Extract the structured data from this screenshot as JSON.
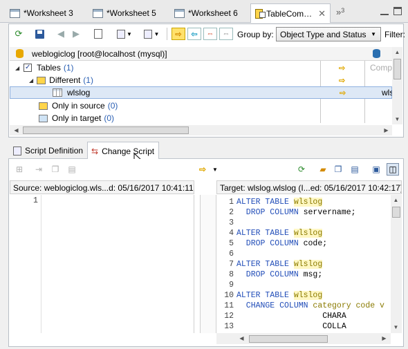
{
  "editor_tabs": [
    {
      "label": "*Worksheet 3",
      "icon": "sql-worksheet-icon"
    },
    {
      "label": "*Worksheet 5",
      "icon": "sql-worksheet-icon"
    },
    {
      "label": "*Worksheet 6",
      "icon": "sql-worksheet-icon"
    },
    {
      "label": "TableCom…",
      "icon": "table-compare-icon",
      "active": true
    }
  ],
  "overflow_tabs_count": "3",
  "toolbar": {
    "group_by_label": "Group by:",
    "group_by_value": "Object Type and Status",
    "filter_label": "Filter:"
  },
  "tree": {
    "source_connection": "weblogiclog [root@localhost (mysql)]",
    "target_column_partial": "Comp",
    "target_item_partial": "wls",
    "rows": [
      {
        "label": "Tables",
        "count": "(1)"
      },
      {
        "label": "Different",
        "count": "(1)"
      },
      {
        "label": "wlslog"
      },
      {
        "label": "Only in source",
        "count": "(0)"
      },
      {
        "label": "Only in target",
        "count": "(0)"
      }
    ]
  },
  "bottom_tabs": {
    "script_definition": "Script Definition",
    "change_script": "Change Script"
  },
  "source_header": "Source: weblogiclog.wls...d: 05/16/2017 10:41:11)",
  "target_header": "Target: wlslog.wlslog (I...ed: 05/16/2017 10:42:17)",
  "source_lines": [
    "1"
  ],
  "script_lines": [
    {
      "n": "1",
      "kw": "ALTER TABLE ",
      "hl": "wlslog",
      "rest": ""
    },
    {
      "n": "2",
      "kw": "  DROP COLUMN ",
      "hl": "",
      "rest": "servername;"
    },
    {
      "n": "3",
      "kw": "",
      "hl": "",
      "rest": ""
    },
    {
      "n": "4",
      "kw": "ALTER TABLE ",
      "hl": "wlslog",
      "rest": ""
    },
    {
      "n": "5",
      "kw": "  DROP COLUMN ",
      "hl": "",
      "rest": "code;"
    },
    {
      "n": "6",
      "kw": "",
      "hl": "",
      "rest": ""
    },
    {
      "n": "7",
      "kw": "ALTER TABLE ",
      "hl": "wlslog",
      "rest": ""
    },
    {
      "n": "8",
      "kw": "  DROP COLUMN ",
      "hl": "",
      "rest": "msg;"
    },
    {
      "n": "9",
      "kw": "",
      "hl": "",
      "rest": ""
    },
    {
      "n": "10",
      "kw": "ALTER TABLE ",
      "hl": "wlslog",
      "rest": ""
    },
    {
      "n": "11",
      "kw": "  CHANGE COLUMN ",
      "hl": "",
      "rest": "category code v"
    },
    {
      "n": "12",
      "kw": "",
      "hl": "",
      "rest": "                  CHARA"
    },
    {
      "n": "13",
      "kw": "",
      "hl": "",
      "rest": "                  COLLA"
    }
  ]
}
